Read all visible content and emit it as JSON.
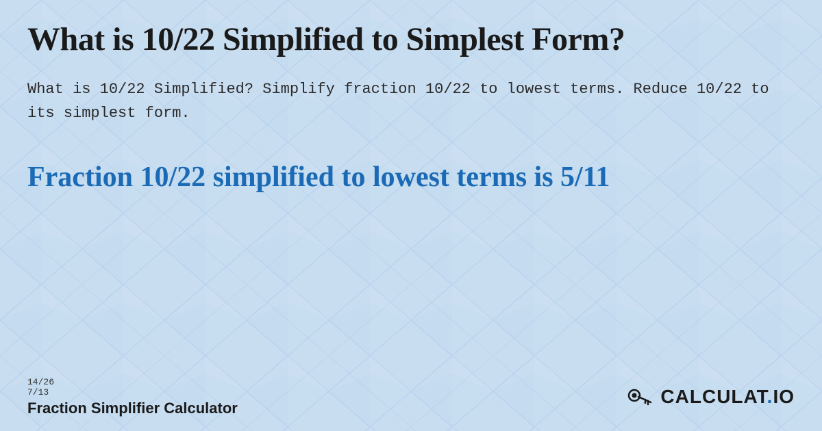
{
  "page": {
    "title": "What is 10/22 Simplified to Simplest Form?",
    "description": "What is 10/22 Simplified? Simplify fraction 10/22 to lowest terms. Reduce 10/22 to its simplest form.",
    "result_heading": "Fraction 10/22 simplified to lowest terms is 5/11",
    "background_color": "#c8ddf0",
    "accent_color": "#1a6ab5"
  },
  "footer": {
    "fraction1": "14/26",
    "fraction2": "7/13",
    "brand_label": "Fraction Simplifier Calculator",
    "logo_text": "CALCULAT.IO"
  },
  "colors": {
    "title_color": "#1a1a1a",
    "result_color": "#1a6ab5",
    "text_color": "#2a2a2a"
  }
}
